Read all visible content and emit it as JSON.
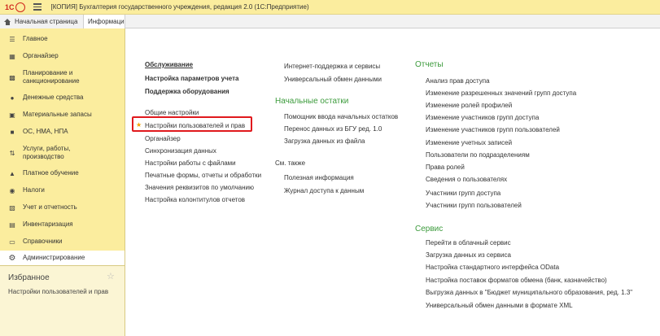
{
  "window": {
    "logo_text": "1С",
    "title": "[КОПИЯ] Бухгалтерия государственного учреждения, редакция 2.0  (1С:Предприятие)"
  },
  "tabs": [
    {
      "label": "Начальная страница"
    },
    {
      "label": "Информаци"
    }
  ],
  "sidebar": {
    "items": [
      {
        "label": "Главное",
        "icon": "list-icon"
      },
      {
        "label": "Органайзер",
        "icon": "calendar-icon"
      },
      {
        "label": "Планирование и санкционирование",
        "icon": "chart-icon"
      },
      {
        "label": "Денежные средства",
        "icon": "coins-icon"
      },
      {
        "label": "Материальные запасы",
        "icon": "boxes-icon"
      },
      {
        "label": "ОС, НМА, НПА",
        "icon": "truck-icon"
      },
      {
        "label": "Услуги, работы, производство",
        "icon": "services-icon"
      },
      {
        "label": "Платное обучение",
        "icon": "graduation-icon"
      },
      {
        "label": "Налоги",
        "icon": "percent-icon"
      },
      {
        "label": "Учет и отчетность",
        "icon": "ledger-icon"
      },
      {
        "label": "Инвентаризация",
        "icon": "clipboard-icon"
      },
      {
        "label": "Справочники",
        "icon": "book-icon"
      },
      {
        "label": "Администрирование",
        "icon": "gear-icon"
      }
    ],
    "favorites": {
      "title": "Избранное",
      "items": [
        "Настройки пользователей и прав"
      ]
    }
  },
  "main": {
    "col1": {
      "top_links": [
        "Обслуживание",
        "Настройка параметров учета",
        "Поддержка оборудования"
      ],
      "links": [
        "Общие настройки",
        "Настройки пользователей и прав",
        "Органайзер",
        "Синхронизация данных",
        "Настройки работы с файлами",
        "Печатные формы, отчеты и обработки",
        "Значения реквизитов по умолчанию",
        "Настройка колонтитулов отчетов"
      ]
    },
    "col2": {
      "top_links": [
        "Интернет-поддержка и сервисы",
        "Универсальный обмен данными"
      ],
      "section1_title": "Начальные остатки",
      "section1_links": [
        "Помощник ввода начальных остатков",
        "Перенос данных из БГУ ред. 1.0",
        "Загрузка данных из файла"
      ],
      "see_also_title": "См. также",
      "see_also_links": [
        "Полезная информация",
        "Журнал доступа к данным"
      ]
    },
    "col3": {
      "reports_title": "Отчеты",
      "reports_links": [
        "Анализ прав доступа",
        "Изменение разрешенных значений групп доступа",
        "Изменение ролей профилей",
        "Изменение участников групп доступа",
        "Изменение участников групп пользователей",
        "Изменение учетных записей",
        "Пользователи по подразделениям",
        "Права ролей",
        "Сведения о пользователях",
        "Участники групп доступа",
        "Участники групп пользователей"
      ],
      "service_title": "Сервис",
      "service_links": [
        "Перейти в облачный сервис",
        "Загрузка данных из сервиса",
        "Настройка стандартного интерфейса OData",
        "Настройка поставок форматов обмена (банк, казначейство)",
        "Выгрузка данных в \"Бюджет муниципального образования, ред. 1.3\"",
        "Универсальный обмен данными в формате XML"
      ]
    }
  }
}
